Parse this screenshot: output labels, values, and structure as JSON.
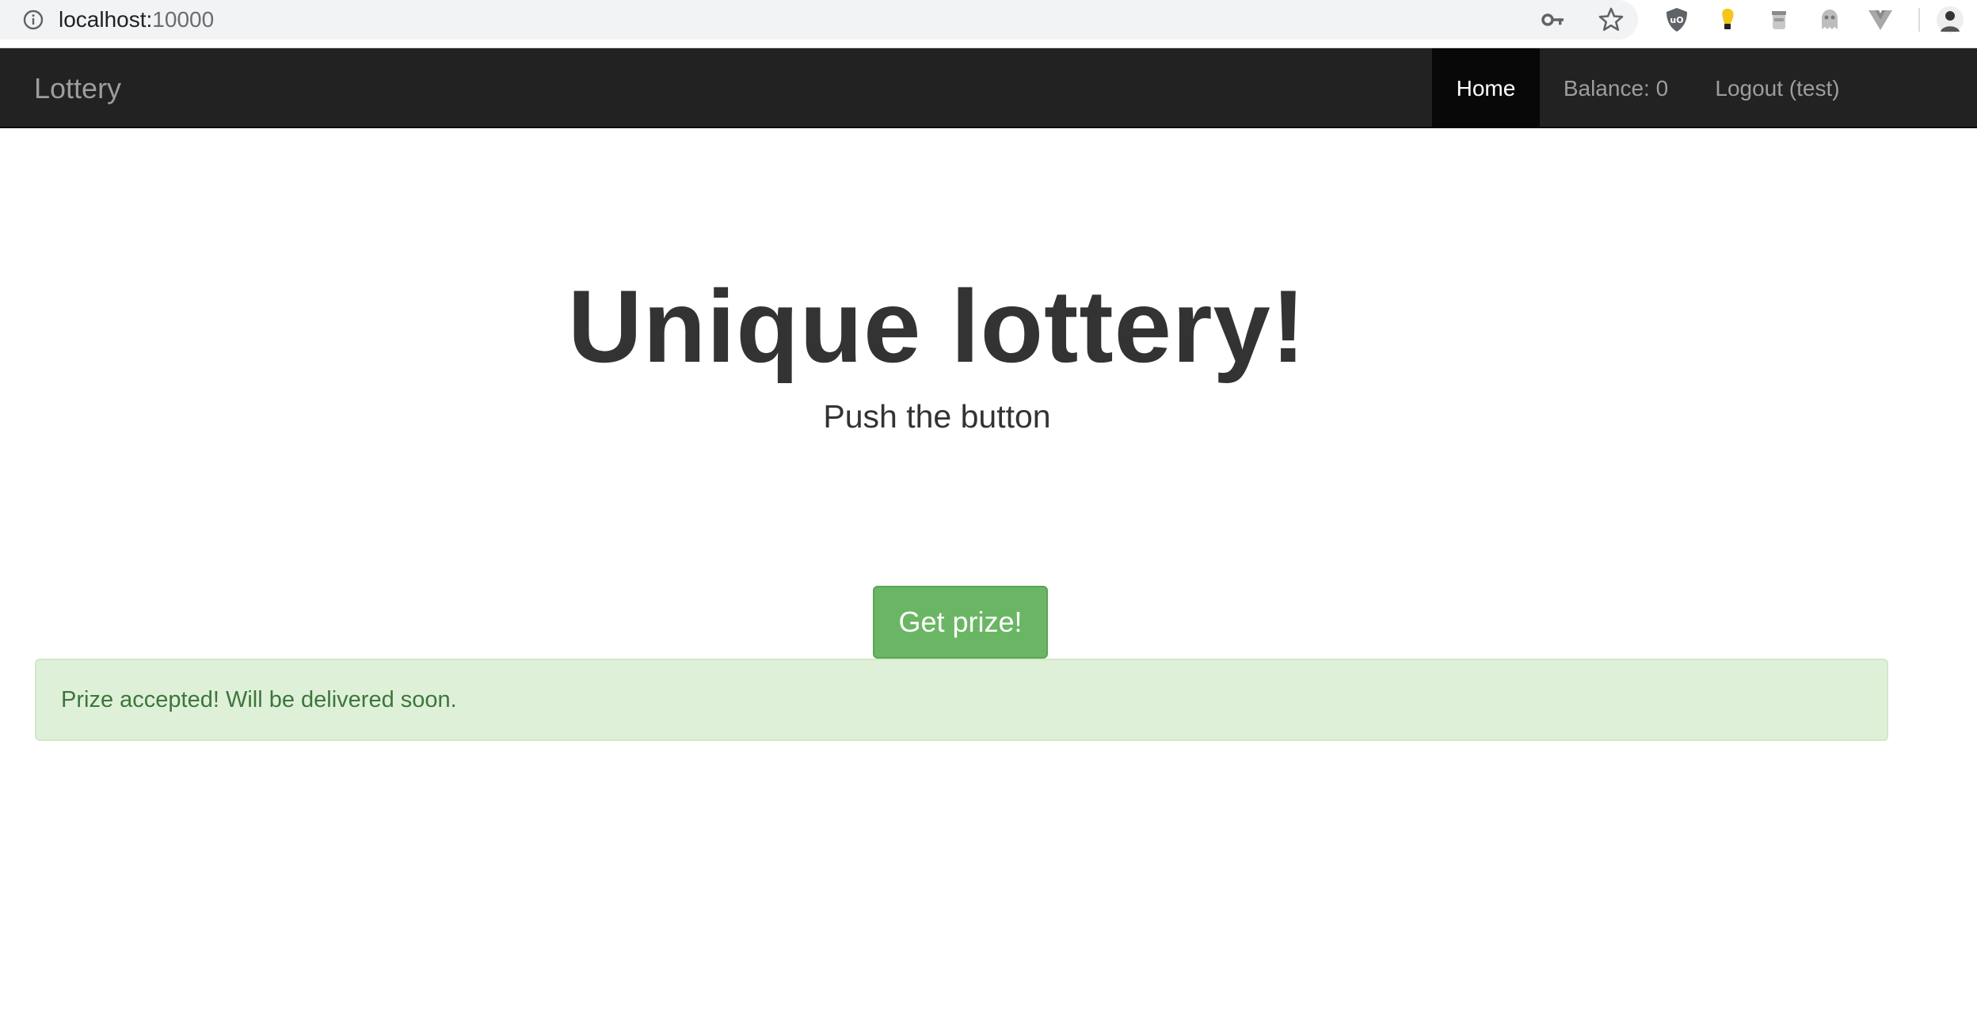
{
  "browser": {
    "url_host": "localhost:",
    "url_port": "10000",
    "info_icon": "info-icon",
    "omnibox_icons": [
      "key-icon",
      "star-icon"
    ],
    "extension_icons": [
      "ublock-shield-icon",
      "lightbulb-icon",
      "jar-icon",
      "ghost-icon",
      "vue-devtools-icon",
      "profile-avatar-icon"
    ]
  },
  "navbar": {
    "brand": "Lottery",
    "items": [
      {
        "label": "Home",
        "active": true
      },
      {
        "label": "Balance: 0",
        "active": false
      },
      {
        "label": "Logout (test)",
        "active": false
      }
    ]
  },
  "hero": {
    "title": "Unique lottery!",
    "subtitle": "Push the button"
  },
  "action": {
    "button_label": "Get prize!"
  },
  "alert": {
    "type": "success",
    "message": "Prize accepted! Will be delivered soon."
  },
  "colors": {
    "navbar_bg": "#222222",
    "navbar_active_bg": "#080808",
    "button_bg": "#6ab664",
    "alert_bg": "#dff0d8",
    "alert_text": "#3c763d"
  }
}
